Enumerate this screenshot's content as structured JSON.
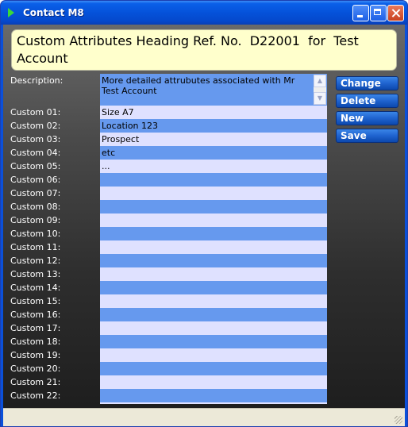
{
  "window": {
    "title": "Contact M8"
  },
  "heading": {
    "text": "Custom Attributes Heading Ref. No.  D22001  for  Test Account"
  },
  "description": {
    "label": "Description:",
    "value": "More detailed attrubutes associated with Mr Test Account"
  },
  "custom": [
    {
      "label": "Custom 01:",
      "value": "Size A7"
    },
    {
      "label": "Custom 02:",
      "value": "Location 123"
    },
    {
      "label": "Custom 03:",
      "value": "Prospect"
    },
    {
      "label": "Custom 04:",
      "value": "etc"
    },
    {
      "label": "Custom 05:",
      "value": "..."
    },
    {
      "label": "Custom 06:",
      "value": ""
    },
    {
      "label": "Custom 07:",
      "value": ""
    },
    {
      "label": "Custom 08:",
      "value": ""
    },
    {
      "label": "Custom 09:",
      "value": ""
    },
    {
      "label": "Custom 10:",
      "value": ""
    },
    {
      "label": "Custom 11:",
      "value": ""
    },
    {
      "label": "Custom 12:",
      "value": ""
    },
    {
      "label": "Custom 13:",
      "value": ""
    },
    {
      "label": "Custom 14:",
      "value": ""
    },
    {
      "label": "Custom 15:",
      "value": ""
    },
    {
      "label": "Custom 16:",
      "value": ""
    },
    {
      "label": "Custom 17:",
      "value": ""
    },
    {
      "label": "Custom 18:",
      "value": ""
    },
    {
      "label": "Custom 19:",
      "value": ""
    },
    {
      "label": "Custom 20:",
      "value": ""
    },
    {
      "label": "Custom 21:",
      "value": ""
    },
    {
      "label": "Custom 22:",
      "value": ""
    }
  ],
  "buttons": {
    "change": "Change",
    "delete": "Delete",
    "new": "New",
    "save": "Save"
  },
  "icons": {
    "app": "play-arrow-icon",
    "minimize": "minimize-icon",
    "maximize": "maximize-icon",
    "close": "close-icon"
  },
  "colors": {
    "heading_bg": "#ffffcc",
    "row_light": "#dfe1ff",
    "row_dark": "#6699ee",
    "button": "#1f63cf"
  }
}
